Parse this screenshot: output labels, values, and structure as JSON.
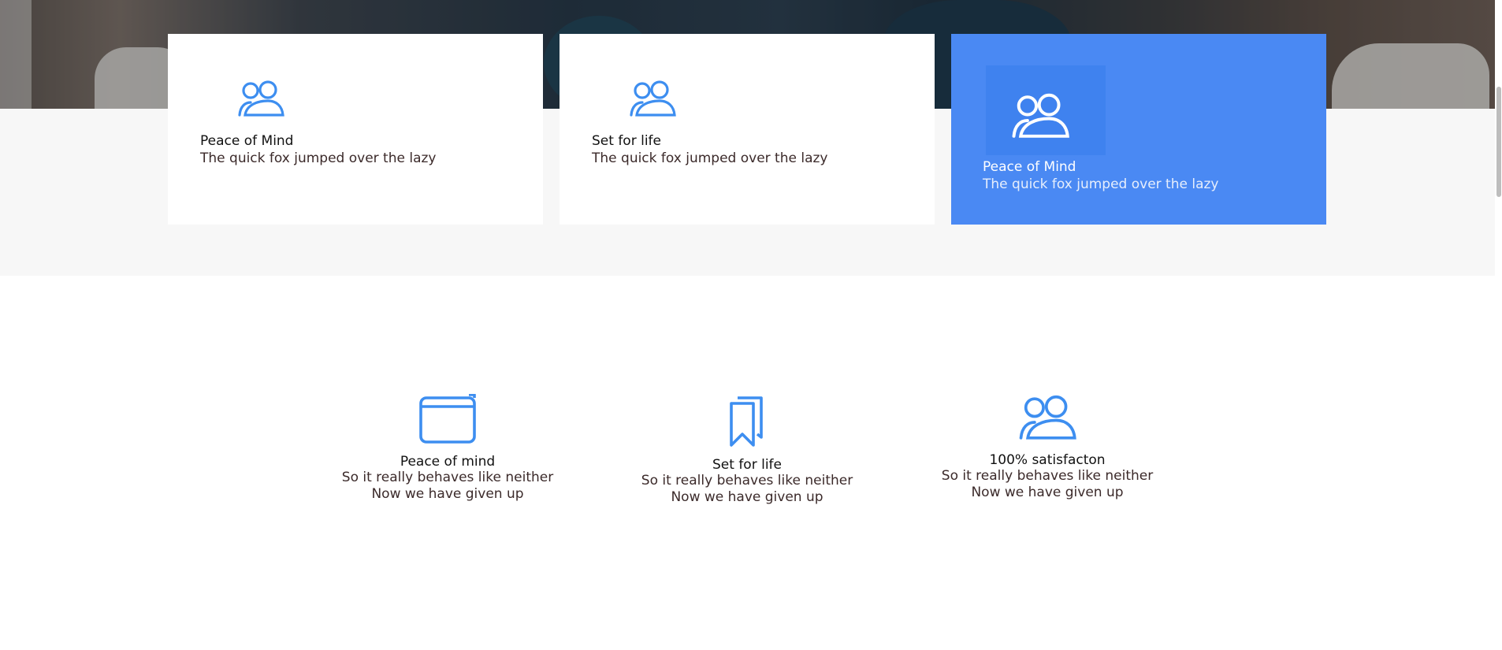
{
  "cards": [
    {
      "icon": "users-icon",
      "title": "Peace of Mind",
      "text": "The quick fox jumped over the lazy"
    },
    {
      "icon": "users-icon",
      "title": "Set for life",
      "text": "The quick fox jumped over the lazy"
    },
    {
      "icon": "users-icon",
      "title": "Peace of Mind",
      "text": "The quick fox jumped over the lazy"
    }
  ],
  "features": [
    {
      "icon": "browser-window-icon",
      "title": "Peace of mind",
      "line1": "So it really behaves like neither",
      "line2": "Now we have given up"
    },
    {
      "icon": "bookmark-icon",
      "title": "Set for life",
      "line1": "So it really behaves like neither",
      "line2": "Now we have given up"
    },
    {
      "icon": "users-icon",
      "title": "100% satisfacton",
      "line1": "So it really behaves like neither",
      "line2": "Now we have given up"
    }
  ],
  "colors": {
    "accent": "#4a89f3",
    "icon_blue": "#3d8ef0",
    "gray_band": "#f7f7f7"
  }
}
